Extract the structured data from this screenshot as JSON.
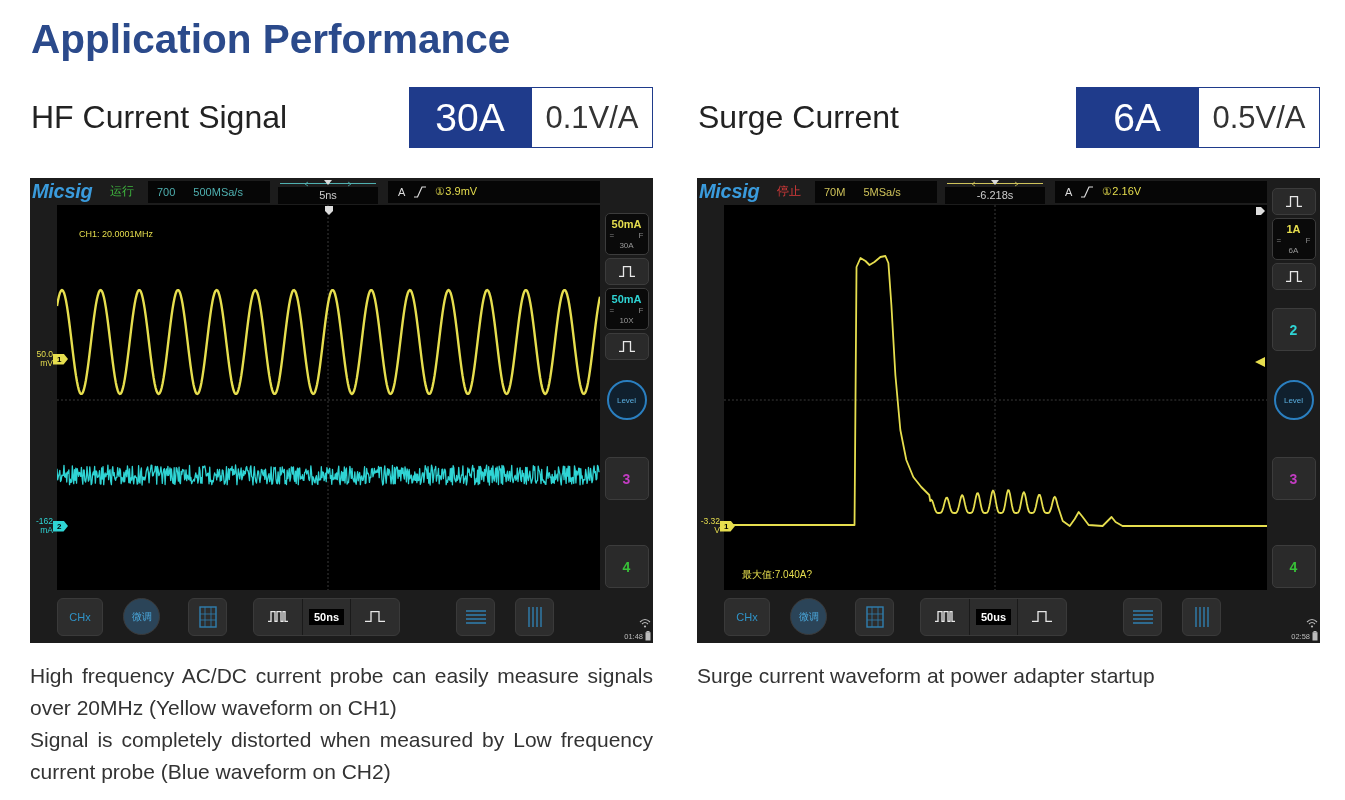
{
  "title": "Application Performance",
  "panels": [
    {
      "heading": "HF Current Signal",
      "range": "30A",
      "sensitivity": "0.1V/A",
      "scope": {
        "brand": "Micsig",
        "run_state": {
          "label": "运行",
          "kind": "running"
        },
        "acquisition": {
          "bandwidth": "700",
          "sample_rate": "500MSa/s",
          "color": "#4fb0b0"
        },
        "horizontal_position": "5ns",
        "trigger": {
          "source": "A",
          "level": "①3.9mV",
          "marker": {
            "kind": "center"
          },
          "level_arrow": false
        },
        "readouts": [
          {
            "kind": "frequency",
            "text": "CH1: 20.0001MHz"
          }
        ],
        "traces": [
          {
            "kind": "sine",
            "color": "#e6de4e",
            "channel": "1",
            "value": "50.0",
            "unit": "mV"
          },
          {
            "kind": "noise",
            "color": "#2fd4d4",
            "channel": "2",
            "value": "-162",
            "unit": "mA"
          }
        ],
        "side_buttons": [
          {
            "kind": "channel",
            "scale": "50mA",
            "coupling": "=",
            "flag": "F",
            "probe": "30A",
            "color": "#e6de4e"
          },
          {
            "kind": "pulse"
          },
          {
            "kind": "channel",
            "scale": "50mA",
            "coupling": "=",
            "flag": "F",
            "probe": "10X",
            "color": "#2fd4d4"
          },
          {
            "kind": "pulse"
          },
          {
            "kind": "level",
            "label": "Level"
          },
          {
            "kind": "number",
            "label": "3",
            "color": "#c23cc2"
          },
          {
            "kind": "number",
            "label": "4",
            "color": "#38c038"
          }
        ],
        "channel_menu": "CHx",
        "fine_tune": "微调",
        "time_per_div": "50ns",
        "clock": "01:48"
      },
      "caption": [
        "High frequency AC/DC current probe can easily measure signals over 20MHz (Yellow waveform on CH1)",
        "Signal is completely distorted when measured by Low frequency current probe (Blue waveform on CH2)"
      ]
    },
    {
      "heading": "Surge Current",
      "range": "6A",
      "sensitivity": "0.5V/A",
      "scope": {
        "brand": "Micsig",
        "run_state": {
          "label": "停止",
          "kind": "stopped"
        },
        "acquisition": {
          "bandwidth": "70M",
          "sample_rate": "5MSa/s",
          "color": "#cfc35a"
        },
        "horizontal_position": "-6.218s",
        "trigger": {
          "source": "A",
          "level": "①2.16V",
          "marker": {
            "kind": "right"
          },
          "level_arrow": true
        },
        "readouts": [
          {
            "kind": "maximum",
            "text": "最大值:7.040A?"
          }
        ],
        "traces": [
          {
            "kind": "surge",
            "color": "#e6de4e",
            "channel": "1",
            "value": "-3.32",
            "unit": "V"
          }
        ],
        "side_buttons": [
          {
            "kind": "pulse"
          },
          {
            "kind": "channel",
            "scale": "1A",
            "coupling": "=",
            "flag": "F",
            "probe": "6A",
            "color": "#e6de4e"
          },
          {
            "kind": "pulse"
          },
          {
            "kind": "number",
            "label": "2",
            "color": "#2fd4d4"
          },
          {
            "kind": "level",
            "label": "Level"
          },
          {
            "kind": "number",
            "label": "3",
            "color": "#c23cc2"
          },
          {
            "kind": "number",
            "label": "4",
            "color": "#38c038"
          }
        ],
        "channel_menu": "CHx",
        "fine_tune": "微调",
        "time_per_div": "50us",
        "clock": "02:58"
      },
      "caption": [
        "Surge current waveform at power adapter startup"
      ]
    }
  ]
}
